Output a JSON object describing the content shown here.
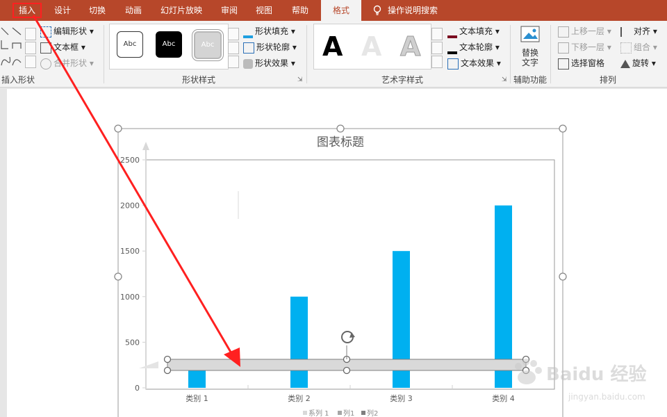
{
  "tabs": [
    "插入",
    "设计",
    "切换",
    "动画",
    "幻灯片放映",
    "审阅",
    "视图",
    "帮助",
    "格式"
  ],
  "tell_me": "操作说明搜索",
  "ribbon": {
    "insert_shapes": {
      "edit_shape": "编辑形状",
      "text_box": "文本框",
      "merge_shapes": "合并形状",
      "label": "插入形状"
    },
    "shape_styles": {
      "samples": [
        "Abc",
        "Abc",
        "Abc"
      ],
      "fill": "形状填充",
      "outline": "形状轮廓",
      "effects": "形状效果",
      "label": "形状样式"
    },
    "wordart": {
      "samples": [
        "A",
        "A",
        "A"
      ],
      "text_fill": "文本填充",
      "text_outline": "文本轮廓",
      "text_effects": "文本效果",
      "label": "艺术字样式"
    },
    "accessibility": {
      "alt_text_line1": "替换",
      "alt_text_line2": "文字",
      "label": "辅助功能"
    },
    "arrange": {
      "bring_forward": "上移一层",
      "send_backward": "下移一层",
      "selection_pane": "选择窗格",
      "align": "对齐",
      "group": "组合",
      "rotate": "旋转",
      "label": "排列"
    }
  },
  "colors": {
    "accent": "#b7472a",
    "bar": "#00b0f0",
    "annotation": "#ff2020"
  },
  "chart_data": {
    "type": "bar",
    "title": "图表标题",
    "categories": [
      "类别 1",
      "类别 2",
      "类别 3",
      "类别 4"
    ],
    "series": [
      {
        "values": [
          200,
          1000,
          1500,
          2000
        ]
      }
    ],
    "ylim": [
      0,
      2500
    ],
    "yticks": [
      "0",
      "500",
      "1000",
      "1500",
      "2000",
      "2500"
    ],
    "legend": [
      "系列 1",
      "列1",
      "列2"
    ]
  },
  "watermark": {
    "brand": "Baidu 经验",
    "url": "jingyan.baidu.com"
  }
}
